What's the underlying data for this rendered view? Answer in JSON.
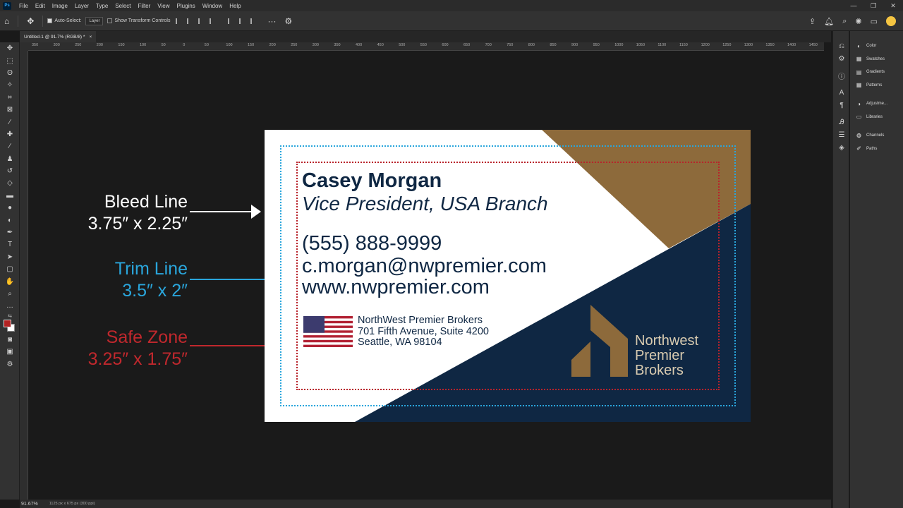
{
  "menubar": {
    "logo": "Ps",
    "items": [
      "File",
      "Edit",
      "Image",
      "Layer",
      "Type",
      "Select",
      "Filter",
      "View",
      "Plugins",
      "Window",
      "Help"
    ]
  },
  "options_bar": {
    "auto_select_label": "Auto-Select:",
    "auto_select_target": "Layer",
    "transform_controls_label": "Show Transform Controls",
    "more_label": "···"
  },
  "document_tab": {
    "title": "Untitled-1 @ 91.7% (RGB/8) *",
    "close": "×"
  },
  "ruler": {
    "ticks": [
      "350",
      "300",
      "250",
      "200",
      "150",
      "100",
      "50",
      "0",
      "50",
      "100",
      "150",
      "200",
      "250",
      "300",
      "350",
      "400",
      "450",
      "500",
      "550",
      "600",
      "650",
      "700",
      "750",
      "800",
      "850",
      "900",
      "950",
      "1000",
      "1050",
      "1100",
      "1150",
      "1200",
      "1250",
      "1300",
      "1350",
      "1400",
      "1450"
    ]
  },
  "status": {
    "zoom": "91.67%",
    "dimensions": "1125 px x 675 px (300 ppi)"
  },
  "panels": {
    "group1": [
      "Color",
      "Swatches",
      "Gradients",
      "Patterns"
    ],
    "group2": [
      "Adjustme...",
      "Libraries"
    ],
    "group3": [
      "Channels",
      "Paths"
    ]
  },
  "annotations": {
    "bleed": {
      "label": "Bleed Line",
      "size": "3.75″ x 2.25″",
      "color": "#ffffff"
    },
    "trim": {
      "label": "Trim Line",
      "size": "3.5″ x 2″",
      "color": "#2aa6dc"
    },
    "safe": {
      "label": "Safe Zone",
      "size": "3.25″ x 1.75″",
      "color": "#c0282d"
    }
  },
  "card": {
    "name": "Casey Morgan",
    "title": "Vice President, USA Branch",
    "phone": "(555) 888-9999",
    "email": "c.morgan@nwpremier.com",
    "website": "www.nwpremier.com",
    "address_line1": "NorthWest Premier Brokers",
    "address_line2": "701 Fifth Avenue, Suite 4200",
    "address_line3": "Seattle, WA 98104",
    "logo_line1": "Northwest",
    "logo_line2": "Premier",
    "logo_line3": "Brokers",
    "colors": {
      "navy": "#0f2743",
      "gold": "#8d6a3b",
      "trim": "#2aa6dc",
      "safe": "#b8232b"
    }
  }
}
